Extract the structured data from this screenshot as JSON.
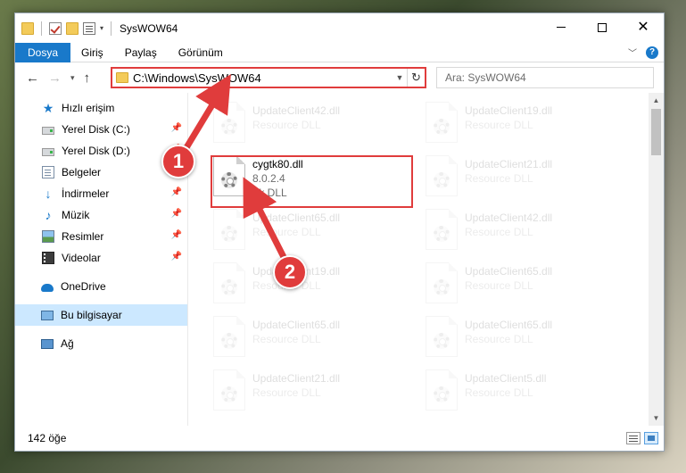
{
  "window": {
    "title": "SysWOW64",
    "quick_access_caret": "▾"
  },
  "ribbon": {
    "tabs": [
      {
        "label": "Dosya",
        "active": true
      },
      {
        "label": "Giriş",
        "active": false
      },
      {
        "label": "Paylaş",
        "active": false
      },
      {
        "label": "Görünüm",
        "active": false
      }
    ],
    "help": "?"
  },
  "address": {
    "path": "C:\\Windows\\SysWOW64",
    "search_placeholder": "Ara: SysWOW64"
  },
  "sidebar": {
    "items": [
      {
        "label": "Hızlı erişim",
        "icon": "star-icon",
        "pinned": false
      },
      {
        "label": "Yerel Disk (C:)",
        "icon": "disk-icon",
        "pinned": true
      },
      {
        "label": "Yerel Disk (D:)",
        "icon": "disk-icon",
        "pinned": true
      },
      {
        "label": "Belgeler",
        "icon": "documents-icon",
        "pinned": true
      },
      {
        "label": "İndirmeler",
        "icon": "download-icon",
        "pinned": true
      },
      {
        "label": "Müzik",
        "icon": "music-icon",
        "pinned": true
      },
      {
        "label": "Resimler",
        "icon": "pictures-icon",
        "pinned": true
      },
      {
        "label": "Videolar",
        "icon": "videos-icon",
        "pinned": true
      },
      {
        "label": "OneDrive",
        "icon": "onedrive-icon",
        "pinned": false
      },
      {
        "label": "Bu bilgisayar",
        "icon": "this-pc-icon",
        "pinned": false,
        "selected": true
      },
      {
        "label": "Ağ",
        "icon": "network-icon",
        "pinned": false
      }
    ]
  },
  "files": {
    "highlighted": {
      "name": "cygtk80.dll",
      "version": "8.0.2.4",
      "type": "Tk DLL"
    },
    "left_column": [
      {
        "name": "UpdateClient42.dll",
        "type": "Resource DLL"
      },
      {
        "name": "UpdateClient65.dll",
        "type": "Resource DLL"
      },
      {
        "name": "UpdateClient19.dll",
        "type": "Resource DLL"
      },
      {
        "name": "UpdateClient65.dll",
        "type": "Resource DLL"
      },
      {
        "name": "UpdateClient21.dll",
        "type": "Resource DLL"
      }
    ],
    "right_column": [
      {
        "name": "UpdateClient19.dll",
        "type": "Resource DLL"
      },
      {
        "name": "UpdateClient21.dll",
        "type": "Resource DLL"
      },
      {
        "name": "UpdateClient42.dll",
        "type": "Resource DLL"
      },
      {
        "name": "UpdateClient65.dll",
        "type": "Resource DLL"
      },
      {
        "name": "UpdateClient65.dll",
        "type": "Resource DLL"
      },
      {
        "name": "UpdateClient5.dll",
        "type": "Resource DLL"
      }
    ]
  },
  "status": {
    "item_count": "142 öğe"
  },
  "annotations": {
    "step1": "1",
    "step2": "2",
    "color": "#e03c3c"
  }
}
